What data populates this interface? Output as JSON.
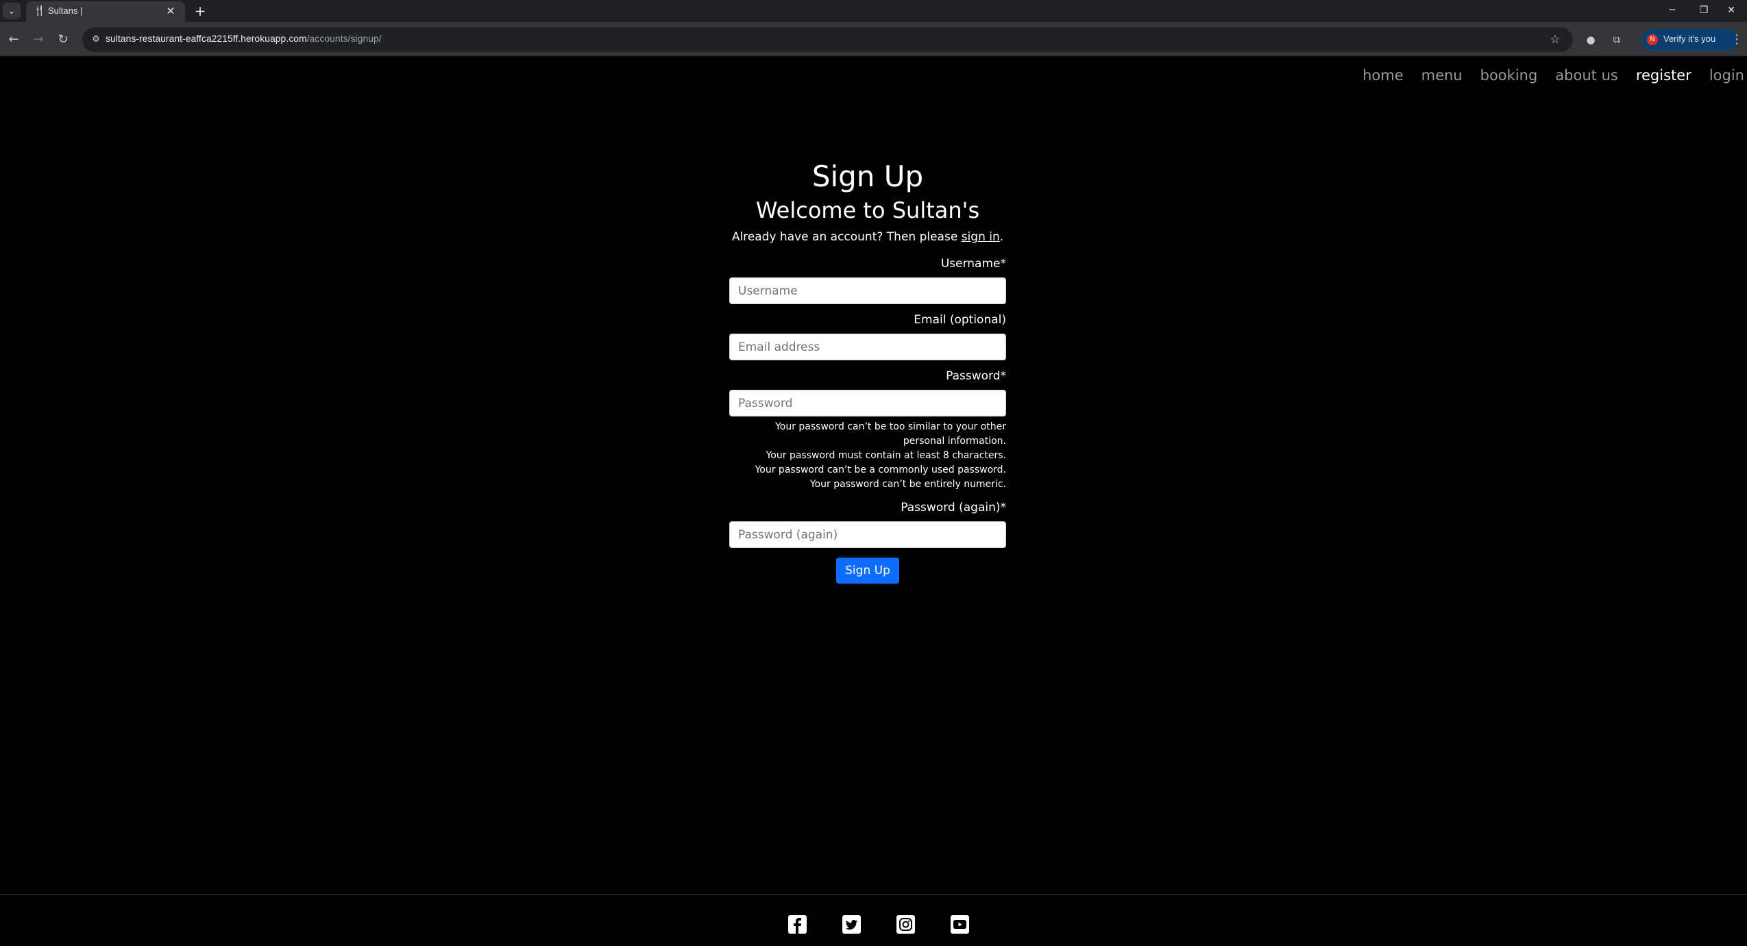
{
  "browser": {
    "tab_title": "Sultans |",
    "url_host": "sultans-restaurant-eaffca2215ff.herokuapp.com",
    "url_path": "/accounts/signup/",
    "verify_label": "Verify it's you",
    "profile_initial": "N",
    "new_tab_glyph": "+",
    "close_glyph": "✕",
    "window_controls": {
      "minimize": "─",
      "restore": "❐",
      "close": "✕"
    }
  },
  "site_nav": {
    "items": [
      {
        "label": "home"
      },
      {
        "label": "menu"
      },
      {
        "label": "booking"
      },
      {
        "label": "about us"
      },
      {
        "label": "register"
      },
      {
        "label": "login"
      }
    ],
    "active": "register"
  },
  "signup": {
    "title": "Sign Up",
    "subtitle": "Welcome to Sultan's",
    "intro_prefix": "Already have an account? Then please ",
    "intro_link": "sign in",
    "intro_suffix": ".",
    "fields": {
      "username": {
        "label": "Username*",
        "placeholder": "Username",
        "value": ""
      },
      "email": {
        "label": "Email (optional)",
        "placeholder": "Email address",
        "value": ""
      },
      "password": {
        "label": "Password*",
        "placeholder": "Password",
        "value": ""
      },
      "password2": {
        "label": "Password (again)*",
        "placeholder": "Password (again)",
        "value": ""
      }
    },
    "password_help": [
      "Your password can’t be too similar to your other personal information.",
      "Your password must contain at least 8 characters.",
      "Your password can’t be a commonly used password.",
      "Your password can’t be entirely numeric."
    ],
    "submit_label": "Sign Up"
  },
  "footer": {
    "social_icons": [
      "facebook-icon",
      "twitter-icon",
      "instagram-icon",
      "youtube-icon"
    ]
  },
  "colors": {
    "page_background": "#000000",
    "nav_active": "#ffffff",
    "nav_inactive": "#9a9a9a",
    "primary_button": "#0d6efd"
  }
}
